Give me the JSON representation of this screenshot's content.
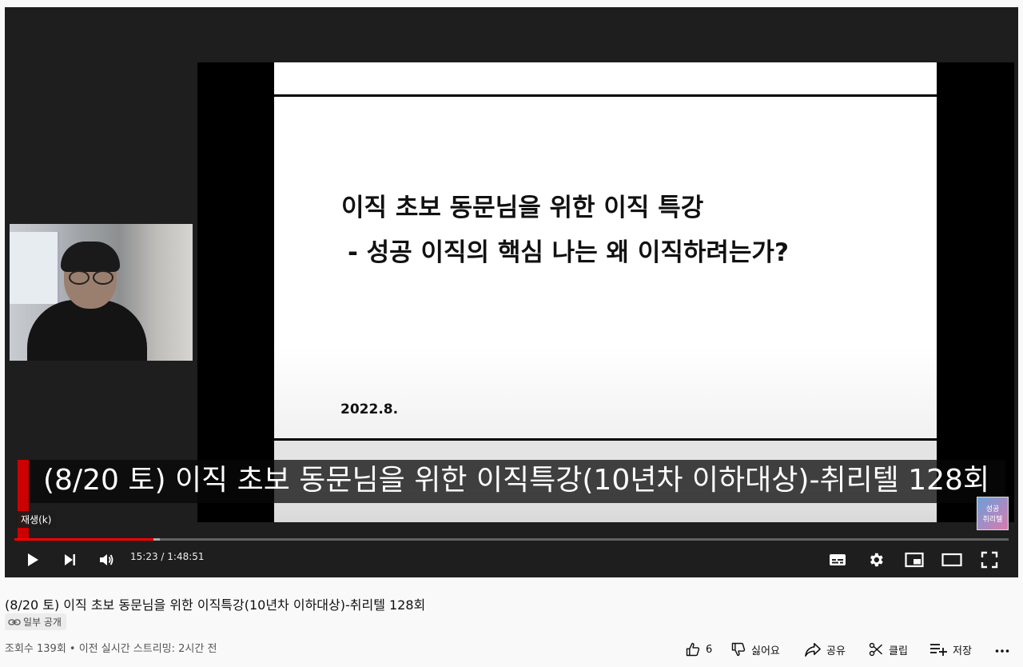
{
  "slide": {
    "title_line1": "이직 초보 동문님을 위한 이직 특강",
    "title_line2": "- 성공 이직의 핵심 나는 왜 이직하려는가?",
    "date": "2022.8."
  },
  "player": {
    "caption": "(8/20 토) 이직 초보 동문님을 위한 이직특강(10년차 이하대상)-취리텔 128회",
    "tooltip": "재생(k)",
    "time_current": "15:23",
    "time_separator": " / ",
    "time_total": "1:48:51",
    "watermark_text": "성공\n취리텔",
    "progress_played": 0.14,
    "progress_buffered": 0.146,
    "accent_color": "#ff0000"
  },
  "video": {
    "title": "(8/20 토) 이직 초보 동문님을 위한 이직특강(10년차 이하대상)-취리텔 128회",
    "visibility": "일부 공개",
    "meta": "조회수 139회 • 이전 실시간 스트리밍: 2시간 전"
  },
  "actions": {
    "like_count": "6",
    "dislike_label": "싫어요",
    "share_label": "공유",
    "clip_label": "클립",
    "save_label": "저장"
  },
  "icons": [
    "play-icon",
    "next-icon",
    "volume-icon",
    "subtitles-icon",
    "settings-icon",
    "miniplayer-icon",
    "theater-icon",
    "fullscreen-icon",
    "link-icon",
    "like-icon",
    "dislike-icon",
    "share-icon",
    "clip-icon",
    "save-icon",
    "more-icon"
  ]
}
